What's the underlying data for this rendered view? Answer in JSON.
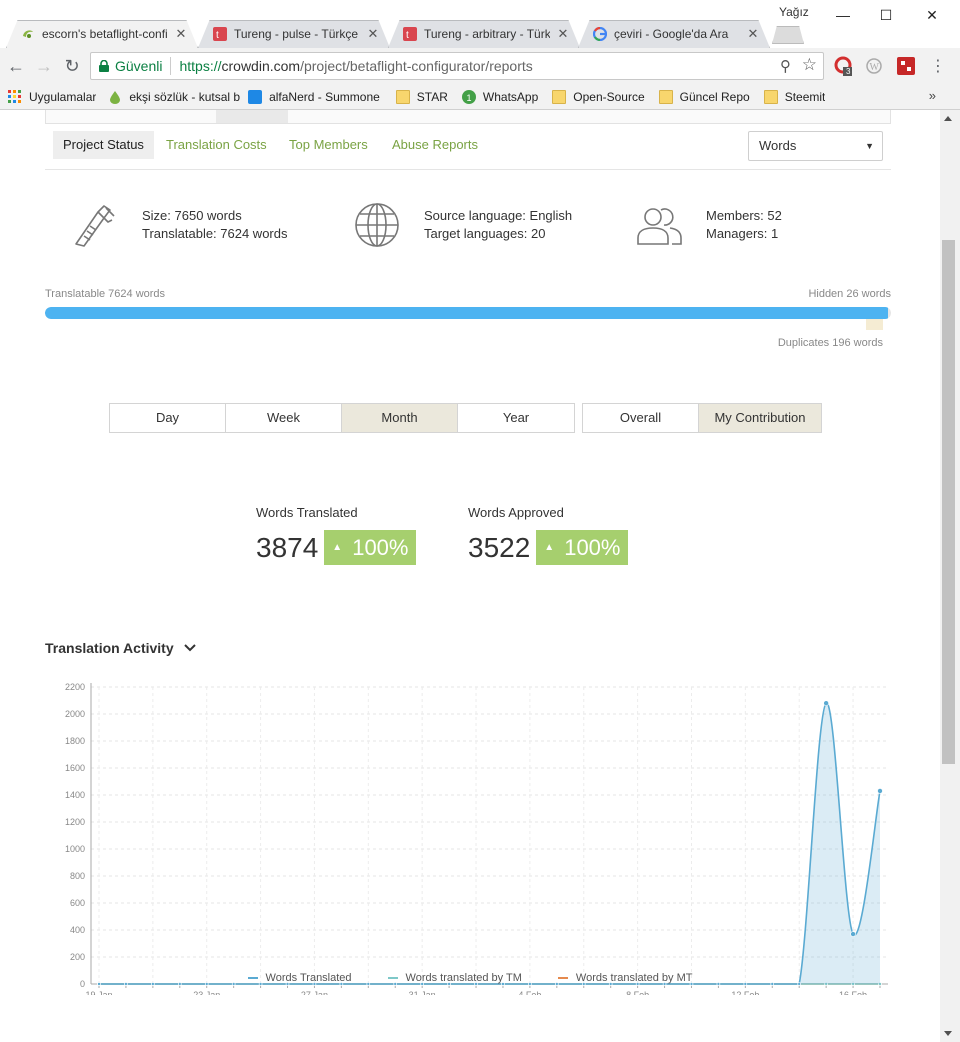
{
  "window": {
    "user": "Yağız"
  },
  "tabs": [
    {
      "title": "escorn's betaflight-confi",
      "active": true,
      "icon": "crowdin-icon"
    },
    {
      "title": "Tureng - pulse - Türkçe",
      "active": false,
      "icon": "tureng-icon"
    },
    {
      "title": "Tureng - arbitrary - Türk",
      "active": false,
      "icon": "tureng-icon"
    },
    {
      "title": "çeviri - Google'da Ara",
      "active": false,
      "icon": "google-icon"
    }
  ],
  "omnibox": {
    "secure_label": "Güvenli",
    "url_proto": "https://",
    "url_host": "crowdin.com",
    "url_path": "/project/betaflight-configurator/reports"
  },
  "extensions": {
    "badge_count": "3"
  },
  "bookmarks": [
    {
      "label": "Uygulamalar",
      "icon": "apps-grid-icon"
    },
    {
      "label": "ekşi sözlük - kutsal b",
      "icon": "drop-icon"
    },
    {
      "label": "alfaNerd - Summone",
      "icon": "alfanerd-icon"
    },
    {
      "label": "STAR",
      "icon": "folder-icon"
    },
    {
      "label": "WhatsApp",
      "icon": "whatsapp-icon"
    },
    {
      "label": "Open-Source",
      "icon": "folder-icon"
    },
    {
      "label": "Güncel Repo",
      "icon": "folder-icon"
    },
    {
      "label": "Steemit",
      "icon": "folder-icon"
    }
  ],
  "subnav": {
    "items": [
      "Project Status",
      "Translation Costs",
      "Top Members",
      "Abuse Reports"
    ],
    "active": "Project Status",
    "select_value": "Words"
  },
  "stats": {
    "size": "Size: 7650 words",
    "translatable": "Translatable: 7624 words",
    "source_language": "Source language: English",
    "target_languages": "Target languages: 20",
    "members": "Members: 52",
    "managers": "Managers: 1"
  },
  "progress": {
    "translatable_label": "Translatable 7624 words",
    "hidden_label": "Hidden 26 words",
    "duplicates_label": "Duplicates 196 words",
    "translatable_words": 7624,
    "hidden_words": 26,
    "duplicates_words": 196,
    "fill_color": "#4db3f1"
  },
  "period_buttons": [
    "Day",
    "Week",
    "Month",
    "Year"
  ],
  "period_active": "Month",
  "scope_buttons": [
    "Overall",
    "My Contribution"
  ],
  "scope_active": "My Contribution",
  "kpis": [
    {
      "label": "Words Translated",
      "value": "3874",
      "change": "100%"
    },
    {
      "label": "Words Approved",
      "value": "3522",
      "change": "100%"
    }
  ],
  "activity_title": "Translation Activity",
  "chart_data": {
    "type": "area",
    "title": "",
    "xlabel": "",
    "ylabel": "",
    "ylim": [
      0,
      2200
    ],
    "y_ticks": [
      0,
      200,
      400,
      600,
      800,
      1000,
      1200,
      1400,
      1600,
      1800,
      2000,
      2200
    ],
    "x_tick_labels": [
      "19 Jan",
      "23 Jan",
      "27 Jan",
      "31 Jan",
      "4 Feb",
      "8 Feb",
      "12 Feb",
      "16 Feb"
    ],
    "x_days": [
      "19 Jan",
      "20 Jan",
      "21 Jan",
      "22 Jan",
      "23 Jan",
      "24 Jan",
      "25 Jan",
      "26 Jan",
      "27 Jan",
      "28 Jan",
      "29 Jan",
      "30 Jan",
      "31 Jan",
      "1 Feb",
      "2 Feb",
      "3 Feb",
      "4 Feb",
      "5 Feb",
      "6 Feb",
      "7 Feb",
      "8 Feb",
      "9 Feb",
      "10 Feb",
      "11 Feb",
      "12 Feb",
      "13 Feb",
      "14 Feb",
      "15 Feb",
      "16 Feb",
      "17 Feb"
    ],
    "grid": true,
    "legend_position": "bottom",
    "series": [
      {
        "name": "Words Translated",
        "color": "#5aaad2",
        "values": [
          0,
          0,
          0,
          0,
          0,
          0,
          0,
          0,
          0,
          0,
          0,
          0,
          0,
          0,
          0,
          0,
          0,
          0,
          0,
          0,
          0,
          0,
          0,
          0,
          0,
          0,
          0,
          2080,
          370,
          1430
        ]
      },
      {
        "name": "Words translated by TM",
        "color": "#7ec8c8",
        "values": [
          0,
          0,
          0,
          0,
          0,
          0,
          0,
          0,
          0,
          0,
          0,
          0,
          0,
          0,
          0,
          0,
          0,
          0,
          0,
          0,
          0,
          0,
          0,
          0,
          0,
          0,
          0,
          0,
          0,
          0
        ]
      },
      {
        "name": "Words translated by MT",
        "color": "#e58a4e",
        "values": [
          0,
          0,
          0,
          0,
          0,
          0,
          0,
          0,
          0,
          0,
          0,
          0,
          0,
          0,
          0,
          0,
          0,
          0,
          0,
          0,
          0,
          0,
          0,
          0,
          0,
          0,
          0,
          0,
          0,
          0
        ]
      }
    ]
  }
}
